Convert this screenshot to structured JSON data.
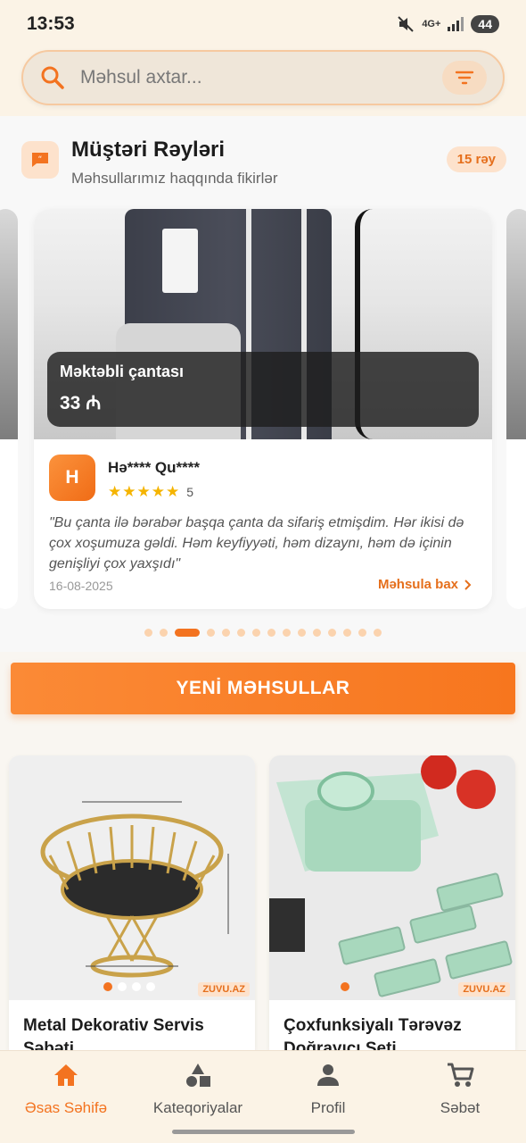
{
  "status_bar": {
    "time": "13:53",
    "network": "4G+",
    "battery": "44"
  },
  "search": {
    "placeholder": "Məhsul axtar..."
  },
  "reviews": {
    "title": "Müştəri Rəyləri",
    "subtitle": "Məhsullarımız haqqında fikirlər",
    "count_badge": "15 rəy",
    "active_card": {
      "product_name": "Məktəbli çantası",
      "price": "33 ₼",
      "reviewer_initial": "H",
      "reviewer_name": "Hə**** Qu****",
      "rating": 5,
      "rating_text": "5",
      "text": "\"Bu çanta ilə bərabər başqa çanta da sifariş etmişdim. Hər ikisi də çox xoşumuza gəldi. Həm keyfiyyəti, həm dizaynı, həm də içinin genişliyi çox yaxşıdı\"",
      "date": "16-08-2025",
      "link_label": "Məhsula bax"
    },
    "carousel": {
      "total": 15,
      "active_index": 2
    }
  },
  "section": {
    "new_products_label": "YENİ MƏHSULLAR"
  },
  "products": [
    {
      "title": "Metal Dekorativ Servis Səbəti",
      "watermark": "ZUVU.AZ",
      "image_count": 4,
      "active_image": 0
    },
    {
      "title": "Çoxfunksiyalı Tərəvəz Doğrayıcı Seti",
      "watermark": "ZUVU.AZ",
      "image_count": 1,
      "active_image": 0
    }
  ],
  "bottom_nav": {
    "items": [
      {
        "label": "Əsas Səhifə",
        "icon": "home-icon",
        "active": true
      },
      {
        "label": "Kateqoriyalar",
        "icon": "categories-icon",
        "active": false
      },
      {
        "label": "Profil",
        "icon": "profile-icon",
        "active": false
      },
      {
        "label": "Səbət",
        "icon": "cart-icon",
        "active": false
      }
    ]
  },
  "colors": {
    "accent": "#f37320",
    "accent_light": "#fde2cc",
    "background": "#fbf3e6",
    "star": "#f5b400"
  }
}
